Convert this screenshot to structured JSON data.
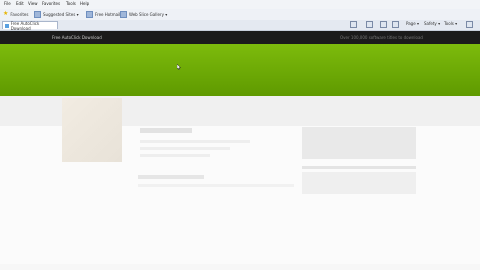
{
  "browser": {
    "menu": [
      "File",
      "Edit",
      "View",
      "Favorites",
      "Tools",
      "Help"
    ],
    "favorites_label": "Favorites",
    "fav_links": [
      "Suggested Sites ▾",
      "Free Hotmail",
      "Web Slice Gallery ▾"
    ],
    "tab_title": "Free AutoClick Download",
    "commands": [
      "Page ▾",
      "Safety ▾",
      "Tools ▾"
    ]
  },
  "site": {
    "logo_text": "Free AutoClick Download",
    "software_count": "Over 100,000 software titles to download"
  },
  "colors": {
    "hero_green": "#6fae05",
    "site_bar": "#1b1b1b"
  }
}
